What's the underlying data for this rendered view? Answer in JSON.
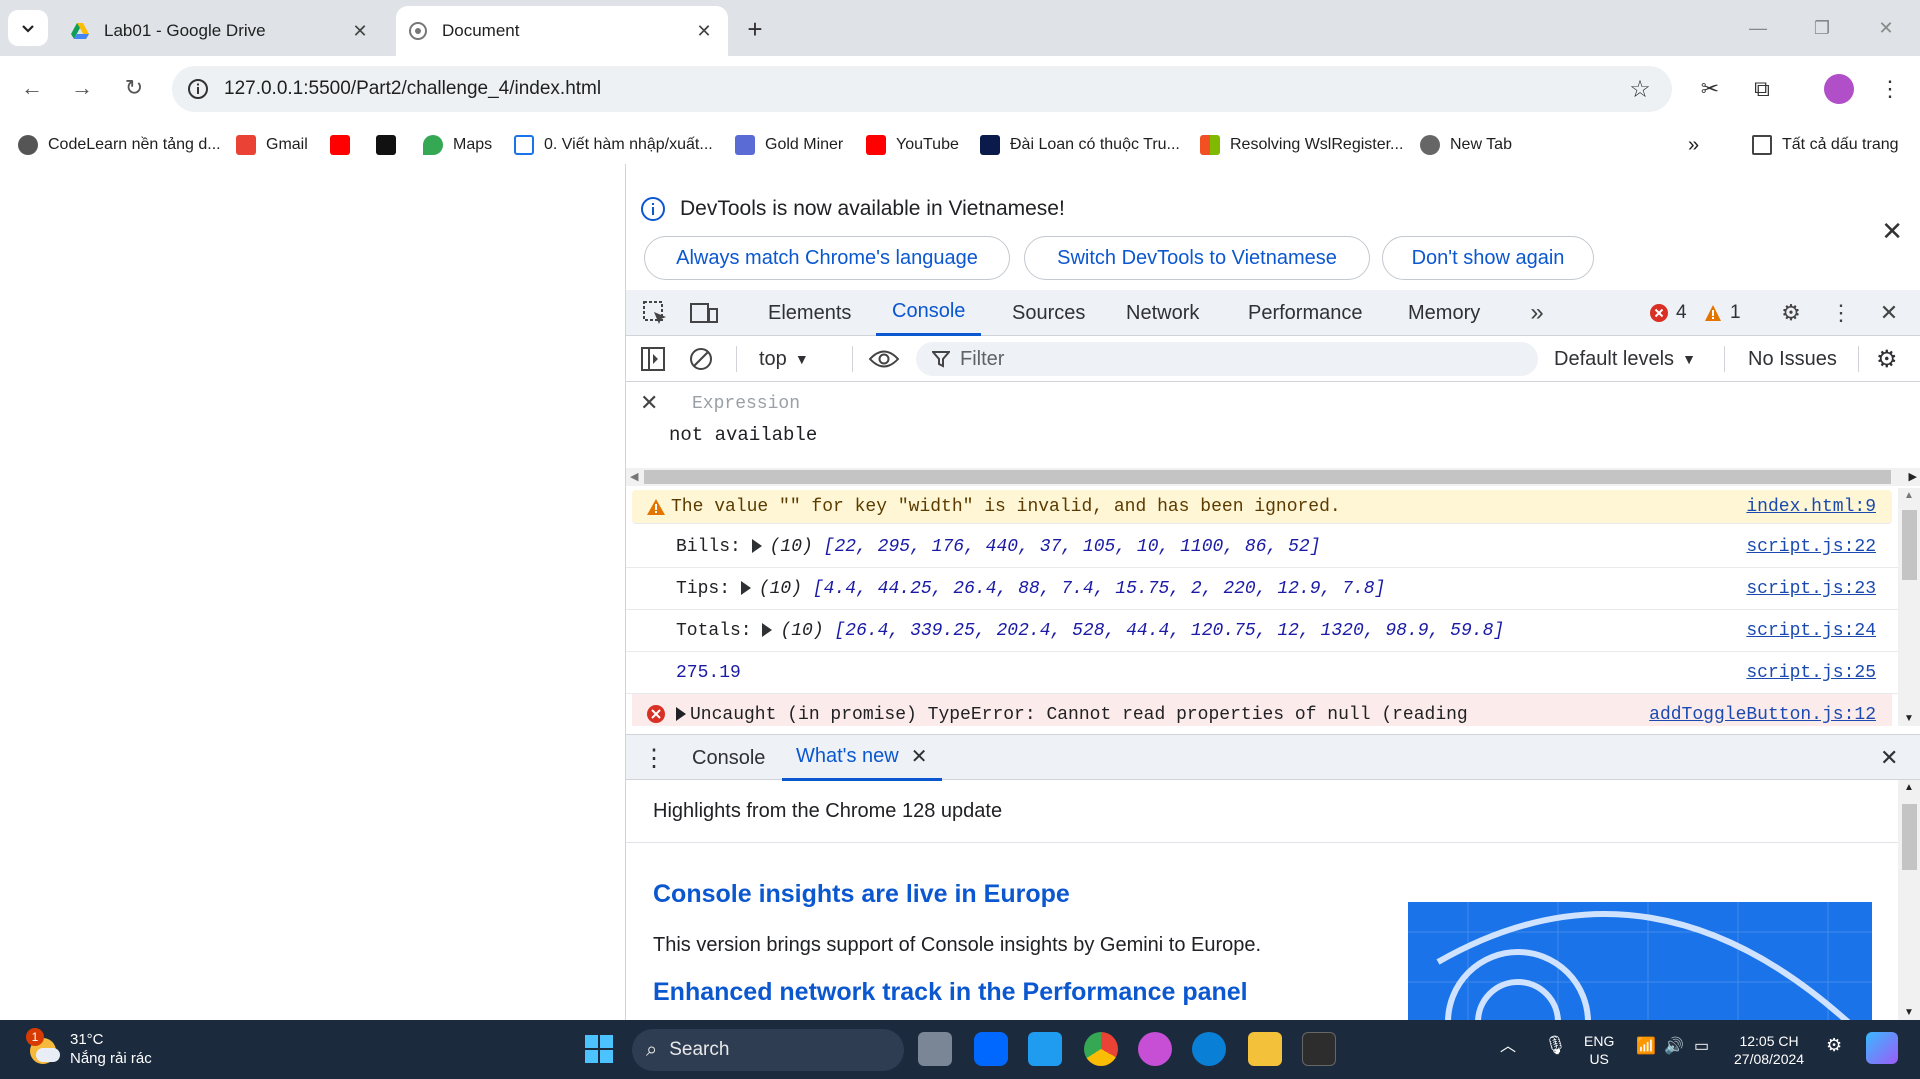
{
  "browser": {
    "tabs": [
      {
        "title": "Lab01 - Google Drive",
        "active": false
      },
      {
        "title": "Document",
        "active": true
      }
    ],
    "url": "127.0.0.1:5500/Part2/challenge_4/index.html"
  },
  "bookmarks": [
    {
      "label": "CodeLearn nền tảng d...",
      "icon": "codelearn-icon"
    },
    {
      "label": "Gmail",
      "icon": "gmail-icon"
    },
    {
      "label": "",
      "icon": "youtube-icon"
    },
    {
      "label": "",
      "icon": "tiktok-icon"
    },
    {
      "label": "Maps",
      "icon": "maps-icon"
    },
    {
      "label": "0. Viết hàm nhập/xuất...",
      "icon": "doc-icon"
    },
    {
      "label": "Gold Miner",
      "icon": "gold-miner-icon"
    },
    {
      "label": "YouTube",
      "icon": "youtube-icon"
    },
    {
      "label": "Đài Loan có thuộc Tru...",
      "icon": "news-icon"
    },
    {
      "label": "Resolving WslRegister...",
      "icon": "microsoft-icon"
    },
    {
      "label": "New Tab",
      "icon": "globe-icon"
    }
  ],
  "bookmarks_all": "Tất cả dấu trang",
  "devtools": {
    "infobar": {
      "message": "DevTools is now available in Vietnamese!",
      "btn_match": "Always match Chrome's language",
      "btn_switch": "Switch DevTools to Vietnamese",
      "btn_dont": "Don't show again"
    },
    "tabs": [
      "Elements",
      "Console",
      "Sources",
      "Network",
      "Performance",
      "Memory"
    ],
    "selected_tab": "Console",
    "error_count": "4",
    "warning_count": "1",
    "console_toolbar": {
      "context": "top",
      "filter_placeholder": "Filter",
      "levels": "Default levels",
      "issues": "No Issues"
    },
    "live_expression": {
      "placeholder": "Expression",
      "value": "not available"
    },
    "logs": {
      "warning": {
        "text": "The value \"\" for key \"width\" is invalid, and has been ignored.",
        "source": "index.html:9"
      },
      "bills": {
        "label": "Bills:",
        "count": "(10)",
        "values": "[22, 295, 176, 440, 37, 105, 10, 1100, 86, 52]",
        "source": "script.js:22"
      },
      "tips": {
        "label": "Tips:",
        "count": "(10)",
        "values": "[4.4, 44.25, 26.4, 88, 7.4, 15.75, 2, 220, 12.9, 7.8]",
        "source": "script.js:23"
      },
      "totals": {
        "label": "Totals:",
        "count": "(10)",
        "values": "[26.4, 339.25, 202.4, 528, 44.4, 120.75, 12, 1320, 98.9, 59.8]",
        "source": "script.js:24"
      },
      "average": {
        "text": "275.19",
        "source": "script.js:25"
      },
      "error": {
        "text": "Uncaught (in promise) TypeError: Cannot read properties of null (reading",
        "source": "addToggleButton.js:12"
      }
    },
    "drawer": {
      "tabs": [
        "Console",
        "What's new"
      ],
      "highlights": "Highlights from the Chrome 128 update",
      "h1": "Console insights are live in Europe",
      "p1": "This version brings support of Console insights by Gemini to Europe.",
      "h2": "Enhanced network track in the Performance panel"
    }
  },
  "taskbar": {
    "weather_temp": "31°C",
    "weather_desc": "Nắng rải rác",
    "weather_badge": "1",
    "search": "Search",
    "lang": "ENG",
    "region": "US",
    "time": "12:05 CH",
    "date": "27/08/2024"
  },
  "colors": {
    "accent": "#0b57d0",
    "error": "#d93025",
    "warning": "#e37400",
    "taskbar": "#1c2a3e"
  }
}
